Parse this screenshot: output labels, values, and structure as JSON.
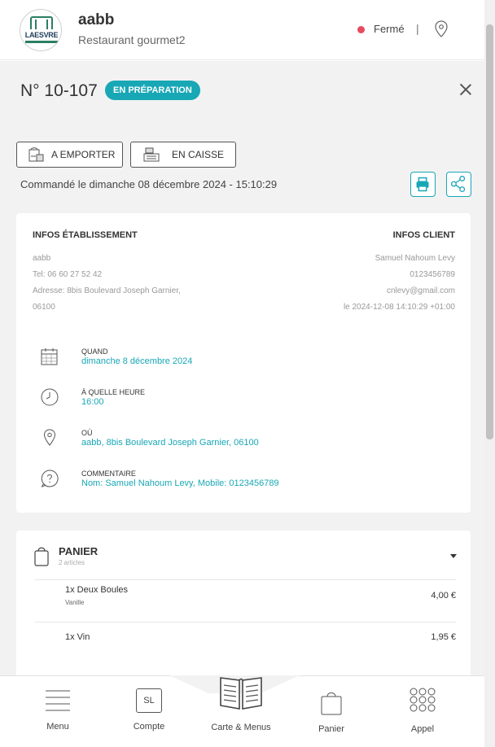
{
  "header": {
    "logo_text": "LAESVRE",
    "shop_name": "aabb",
    "shop_subtitle": "Restaurant gourmet2",
    "status": "Fermé",
    "status_color": "#e84a5f",
    "separator": "|",
    "location_icon": "map-pin-icon"
  },
  "order": {
    "number": "N° 10-107",
    "status_badge": "EN PRÉPARATION",
    "badge_color": "#18a7b5",
    "tags": [
      {
        "label": "A EMPORTER",
        "icon": "takeaway-bag-icon"
      },
      {
        "label": "EN CAISSE",
        "icon": "cash-register-icon"
      }
    ],
    "ordered_at": "Commandé le dimanche 08 décembre 2024 - 15:10:29",
    "print_icon": "printer-icon",
    "share_icon": "share-icon"
  },
  "establishment": {
    "heading": "INFOS ÉTABLISSEMENT",
    "lines": [
      "aabb",
      "Tel: 06 60 27 52 42",
      "Adresse: 8bis Boulevard Joseph Garnier,",
      "06100"
    ]
  },
  "client": {
    "heading": "INFOS CLIENT",
    "lines": [
      "Samuel Nahoum Levy",
      "0123456789",
      "cnlevy@gmail.com",
      "le 2024-12-08 14:10:29 +01:00"
    ]
  },
  "details": [
    {
      "label": "QUAND",
      "value": "dimanche 8 décembre 2024",
      "icon": "calendar-icon"
    },
    {
      "label": "À QUELLE HEURE",
      "value": "16:00",
      "icon": "clock-icon"
    },
    {
      "label": "OÙ",
      "value": "aabb, 8bis Boulevard Joseph Garnier, 06100",
      "icon": "location-icon"
    },
    {
      "label": "COMMENTAIRE",
      "value": "Nom: Samuel Nahoum Levy, Mobile: 0123456789",
      "icon": "question-icon"
    }
  ],
  "cart": {
    "title": "PANIER",
    "count": "2 articles",
    "items": [
      {
        "name": "1x Deux Boules",
        "option": "Vanille",
        "price": "4,00 €"
      },
      {
        "name": "1x Vin",
        "option": "",
        "price": "1,95 €"
      }
    ]
  },
  "nav": {
    "items": [
      {
        "label": "Menu",
        "icon": "hamburger-icon"
      },
      {
        "label": "Compte",
        "icon": "account-initials-icon",
        "initials": "SL"
      },
      {
        "label": "Carte & Menus",
        "icon": "open-book-icon"
      },
      {
        "label": "Panier",
        "icon": "shopping-bag-icon"
      },
      {
        "label": "Appel",
        "icon": "dial-pad-icon"
      }
    ]
  }
}
